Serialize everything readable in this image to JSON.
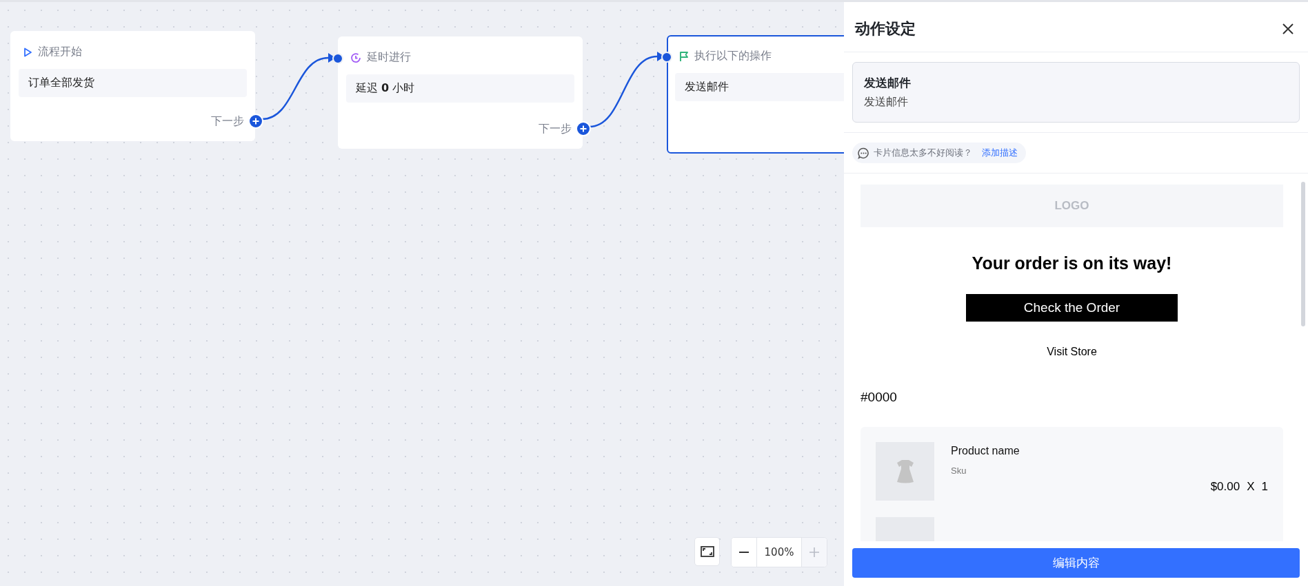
{
  "nodes": [
    {
      "kind": "start",
      "title": "流程开始",
      "body": "订单全部发货",
      "next": "下一步",
      "selected": false
    },
    {
      "kind": "delay",
      "title": "延时进行",
      "body": "延迟 **0** 小时",
      "next": "下一步",
      "selected": false
    },
    {
      "kind": "action",
      "title": "执行以下的操作",
      "body": "发送邮件",
      "selected": true
    }
  ],
  "zoom": {
    "value": "100%",
    "zoom_in_disabled": true
  },
  "panel": {
    "title": "动作设定",
    "summary": {
      "title": "发送邮件",
      "subtitle": "发送邮件"
    },
    "hint": {
      "text": "卡片信息太多不好阅读？",
      "link": "添加描述"
    },
    "email": {
      "logo": "LOGO",
      "heading": "Your order is on its way!",
      "button": "Check the Order",
      "link": "Visit Store",
      "order_number": "#0000",
      "products": [
        {
          "name": "Product name",
          "sku": "Sku",
          "price": "$0.00",
          "times": "X",
          "qty": "1"
        },
        {
          "kind": "cut"
        }
      ]
    },
    "footer_button": "编辑内容"
  }
}
